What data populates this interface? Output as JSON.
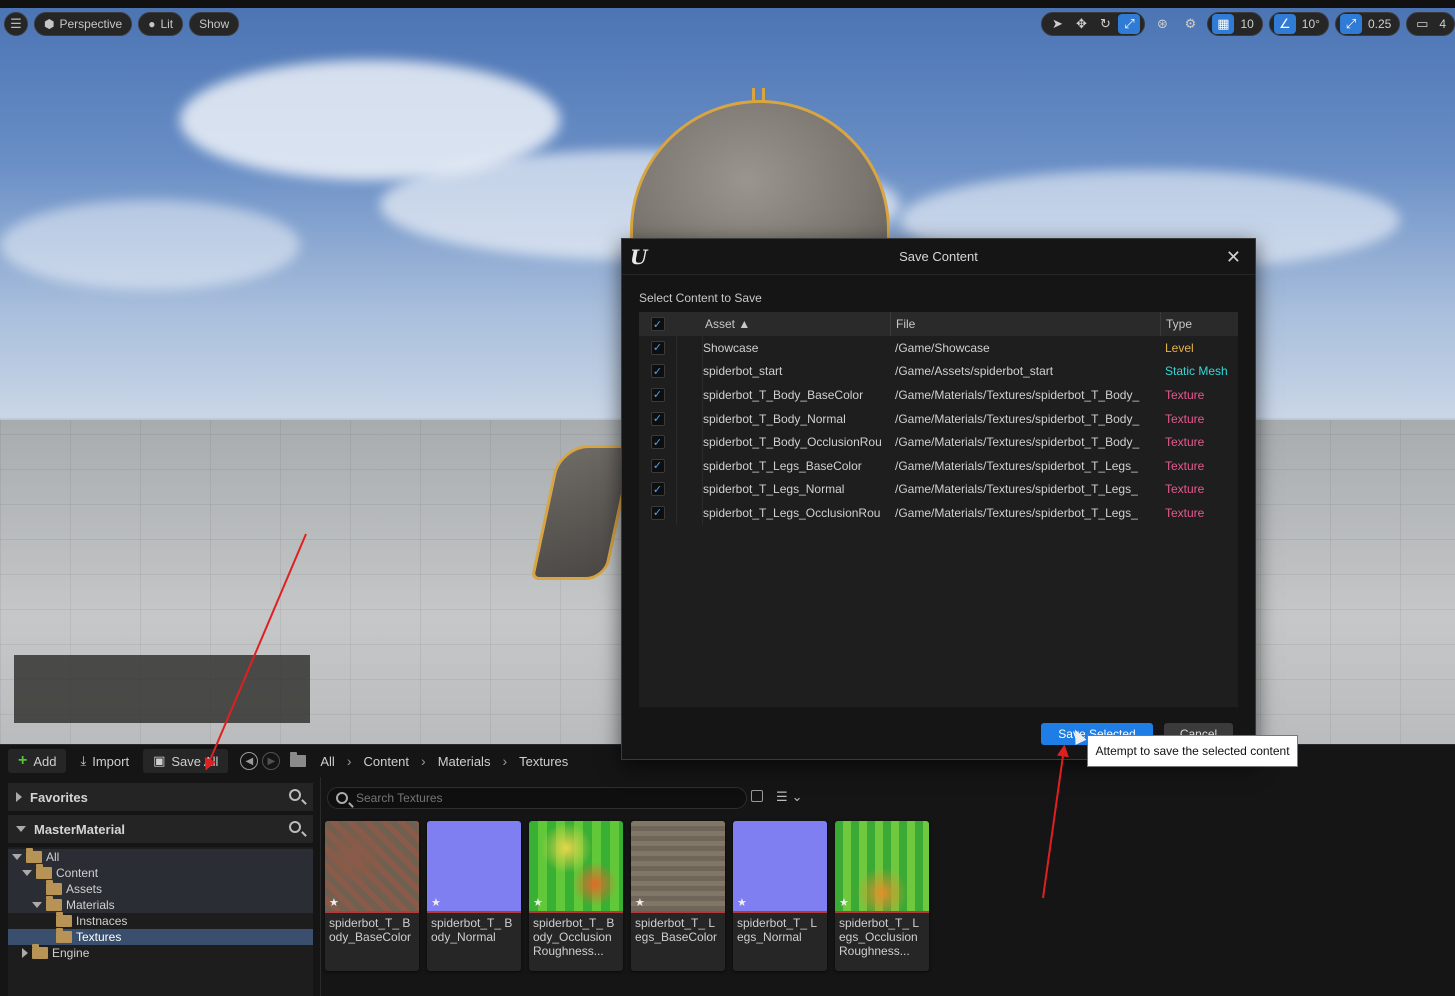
{
  "viewport": {
    "mode_label": "Perspective",
    "lighting_label": "Lit",
    "show_label": "Show",
    "grid_snap_value": "10",
    "rotation_snap_value": "10°",
    "scale_snap_value": "0.25",
    "camera_speed_value": "4"
  },
  "dialog": {
    "title": "Save Content",
    "subtitle": "Select Content to Save",
    "columns": {
      "asset": "Asset ▲",
      "file": "File",
      "type": "Type"
    },
    "rows": [
      {
        "asset": "Showcase",
        "file": "/Game/Showcase",
        "type": "Level"
      },
      {
        "asset": "spiderbot_start",
        "file": "/Game/Assets/spiderbot_start",
        "type": "Static Mesh"
      },
      {
        "asset": "spiderbot_T_Body_BaseColor",
        "file": "/Game/Materials/Textures/spiderbot_T_Body_",
        "type": "Texture"
      },
      {
        "asset": "spiderbot_T_Body_Normal",
        "file": "/Game/Materials/Textures/spiderbot_T_Body_",
        "type": "Texture"
      },
      {
        "asset": "spiderbot_T_Body_OcclusionRou",
        "file": "/Game/Materials/Textures/spiderbot_T_Body_",
        "type": "Texture"
      },
      {
        "asset": "spiderbot_T_Legs_BaseColor",
        "file": "/Game/Materials/Textures/spiderbot_T_Legs_",
        "type": "Texture"
      },
      {
        "asset": "spiderbot_T_Legs_Normal",
        "file": "/Game/Materials/Textures/spiderbot_T_Legs_",
        "type": "Texture"
      },
      {
        "asset": "spiderbot_T_Legs_OcclusionRou",
        "file": "/Game/Materials/Textures/spiderbot_T_Legs_",
        "type": "Texture"
      }
    ],
    "save_button": "Save Selected",
    "cancel_button": "Cancel",
    "tooltip": "Attempt to save the selected content"
  },
  "content_browser": {
    "add_label": "Add",
    "import_label": "Import",
    "save_all_label": "Save All",
    "breadcrumbs": [
      "All",
      "Content",
      "Materials",
      "Textures"
    ],
    "favorites_label": "Favorites",
    "project_label": "MasterMaterial",
    "tree": [
      "All",
      "Content",
      "Assets",
      "Materials",
      "Instnaces",
      "Textures",
      "Engine"
    ],
    "search_placeholder": "Search Textures",
    "assets": [
      {
        "name": "spiderbot_T_ Body_BaseColor"
      },
      {
        "name": "spiderbot_T_ Body_Normal"
      },
      {
        "name": "spiderbot_T_ Body_Occlusion Roughness..."
      },
      {
        "name": "spiderbot_T_ Legs_BaseColor"
      },
      {
        "name": "spiderbot_T_ Legs_Normal"
      },
      {
        "name": "spiderbot_T_ Legs_Occlusion Roughness..."
      }
    ]
  },
  "colors": {
    "accent": "#1f7ee6",
    "type_level": "#e6b445",
    "type_mesh": "#35d7d7",
    "type_texture": "#e35a8d",
    "annotation_arrow": "#e02020"
  }
}
